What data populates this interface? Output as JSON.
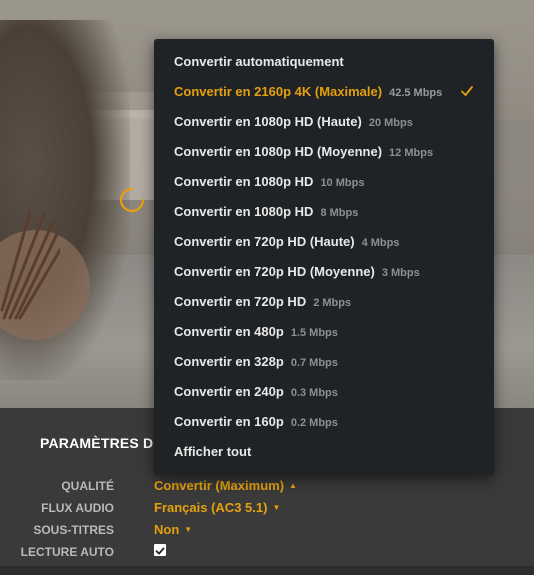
{
  "dropdown": {
    "items": [
      {
        "label": "Convertir automatiquement",
        "rate": ""
      },
      {
        "label": "Convertir en 2160p 4K (Maximale)",
        "rate": "42.5 Mbps"
      },
      {
        "label": "Convertir en 1080p HD (Haute)",
        "rate": "20 Mbps"
      },
      {
        "label": "Convertir en 1080p HD (Moyenne)",
        "rate": "12 Mbps"
      },
      {
        "label": "Convertir en 1080p HD",
        "rate": "10 Mbps"
      },
      {
        "label": "Convertir en 1080p HD",
        "rate": "8 Mbps"
      },
      {
        "label": "Convertir en 720p HD (Haute)",
        "rate": "4 Mbps"
      },
      {
        "label": "Convertir en 720p HD (Moyenne)",
        "rate": "3 Mbps"
      },
      {
        "label": "Convertir en 720p HD",
        "rate": "2 Mbps"
      },
      {
        "label": "Convertir en 480p",
        "rate": "1.5 Mbps"
      },
      {
        "label": "Convertir en 328p",
        "rate": "0.7 Mbps"
      },
      {
        "label": "Convertir en 240p",
        "rate": "0.3 Mbps"
      },
      {
        "label": "Convertir en 160p",
        "rate": "0.2 Mbps"
      },
      {
        "label": "Afficher tout",
        "rate": ""
      }
    ],
    "selected_index": 1,
    "check_icon": "checkmark-icon"
  },
  "settings": {
    "title": "PARAMÈTRES DE",
    "quality_label": "QUALITÉ",
    "quality_value": "Convertir (Maximum)",
    "quality_caret": "▲",
    "audio_label": "FLUX AUDIO",
    "audio_value": "Français (AC3 5.1)",
    "audio_caret": "▼",
    "subtitles_label": "SOUS-TITRES",
    "subtitles_value": "Non",
    "subtitles_caret": "▼",
    "autoplay_label": "LECTURE AUTO",
    "autoplay_checked": true
  },
  "colors": {
    "accent": "#e5a00d",
    "menu_bg": "#1f2326",
    "panel_bg": "#3a3a3a"
  },
  "icons": {
    "spinner": "loading-spinner-icon",
    "checkbox": "checkbox-checked-icon"
  }
}
